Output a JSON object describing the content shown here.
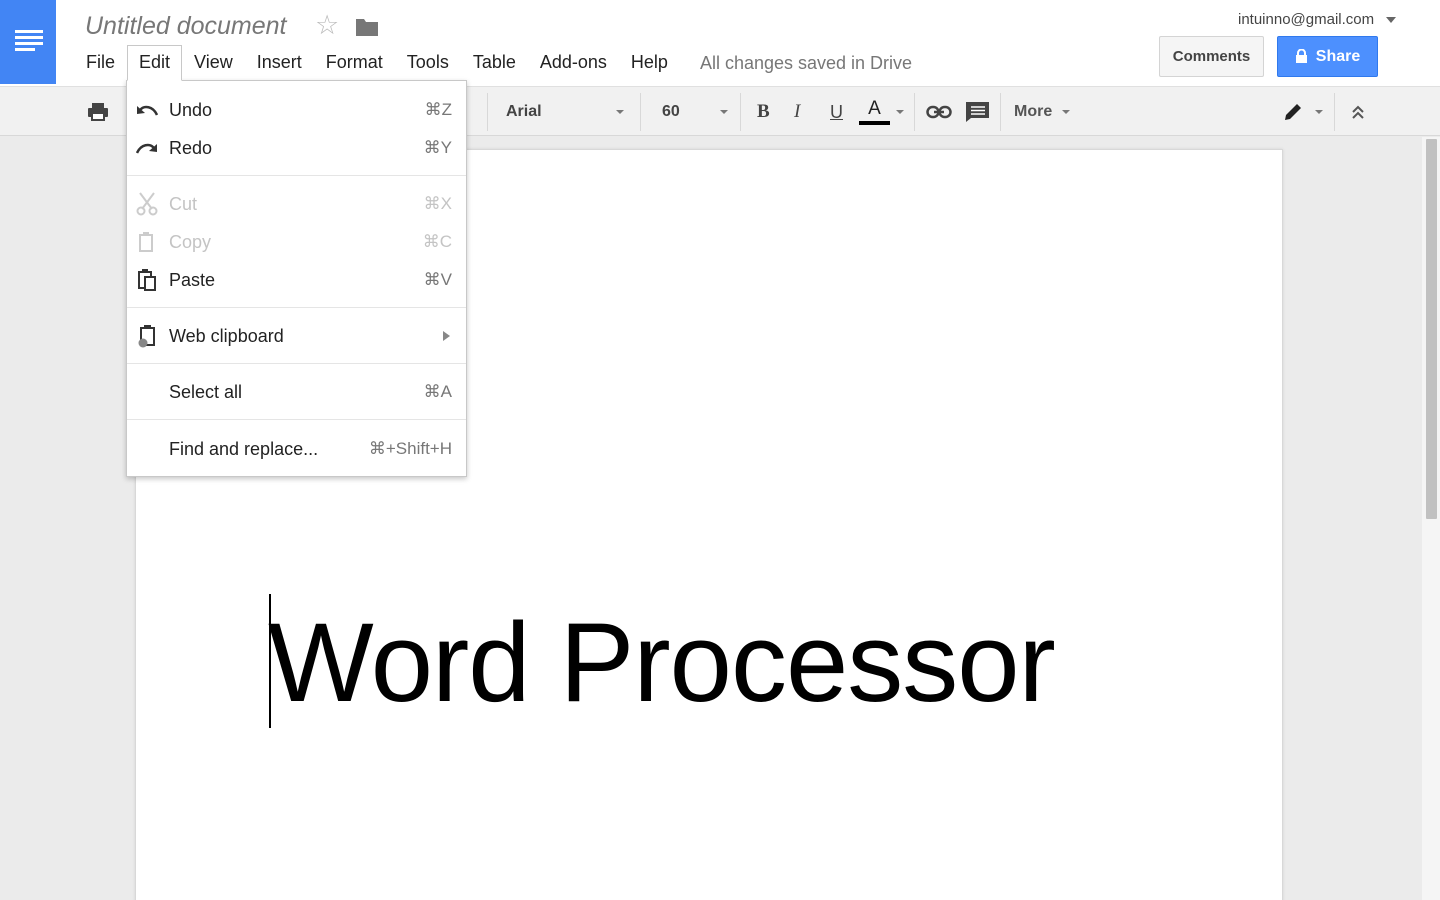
{
  "header": {
    "doc_title": "Untitled document",
    "menus": [
      "File",
      "Edit",
      "View",
      "Insert",
      "Format",
      "Tools",
      "Table",
      "Add-ons",
      "Help"
    ],
    "save_status": "All changes saved in Drive",
    "user_email": "intuinno@gmail.com",
    "comments_label": "Comments",
    "share_label": "Share"
  },
  "toolbar": {
    "font_name": "Arial",
    "font_size": "60",
    "bold": "B",
    "italic": "I",
    "underline": "U",
    "text_color_label": "A",
    "more_label": "More"
  },
  "edit_menu": {
    "items": [
      {
        "label": "Undo",
        "shortcut": "⌘Z",
        "disabled": false,
        "icon": "undo-icon"
      },
      {
        "label": "Redo",
        "shortcut": "⌘Y",
        "disabled": false,
        "icon": "redo-icon"
      },
      {
        "label": "Cut",
        "shortcut": "⌘X",
        "disabled": true,
        "icon": "cut-icon"
      },
      {
        "label": "Copy",
        "shortcut": "⌘C",
        "disabled": true,
        "icon": "copy-icon"
      },
      {
        "label": "Paste",
        "shortcut": "⌘V",
        "disabled": false,
        "icon": "paste-icon"
      },
      {
        "label": "Web clipboard",
        "shortcut": "",
        "disabled": false,
        "icon": "web-clipboard-icon"
      },
      {
        "label": "Select all",
        "shortcut": "⌘A",
        "disabled": false,
        "icon": ""
      },
      {
        "label": "Find and replace...",
        "shortcut": "⌘+Shift+H",
        "disabled": false,
        "icon": ""
      }
    ]
  },
  "document": {
    "body_text": "Word Processor"
  },
  "colors": {
    "brand_blue": "#4285f4",
    "share_blue": "#4d90fe",
    "text_color_bar": "#000000"
  }
}
